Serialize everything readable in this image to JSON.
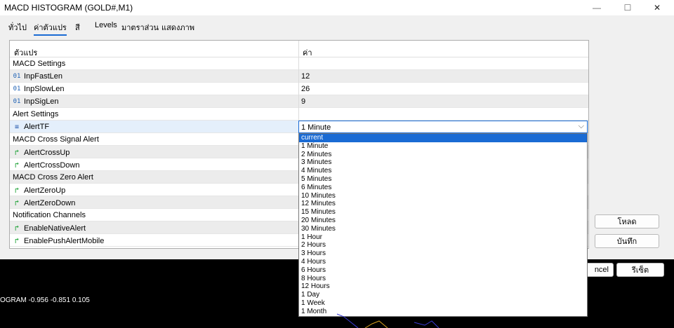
{
  "window": {
    "title": "MACD HISTOGRAM (GOLD#,M1)"
  },
  "tabs": [
    {
      "label": "ทั่วไป"
    },
    {
      "label": "ค่าตัวแปร"
    },
    {
      "label": "สี"
    },
    {
      "label": "Levels"
    },
    {
      "label": "มาตราส่วน"
    },
    {
      "label": "แสดงภาพ"
    }
  ],
  "grid": {
    "col_param": "ตัวแปร",
    "col_value": "ค่า",
    "rows": [
      {
        "label": "MACD Settings",
        "value": ""
      },
      {
        "icon": "01",
        "label": "InpFastLen",
        "value": "12"
      },
      {
        "icon": "01",
        "label": "InpSlowLen",
        "value": "26"
      },
      {
        "icon": "01",
        "label": "InpSigLen",
        "value": "9"
      },
      {
        "label": "Alert Settings",
        "value": ""
      },
      {
        "label": "AlertTF",
        "value": ""
      },
      {
        "label": "MACD Cross Signal Alert",
        "value": ""
      },
      {
        "label": "AlertCrossUp",
        "value": ""
      },
      {
        "label": "AlertCrossDown",
        "value": ""
      },
      {
        "label": "MACD Cross Zero Alert",
        "value": ""
      },
      {
        "label": "AlertZeroUp",
        "value": ""
      },
      {
        "label": "AlertZeroDown",
        "value": ""
      },
      {
        "label": "Notification Channels",
        "value": ""
      },
      {
        "label": "EnableNativeAlert",
        "value": ""
      },
      {
        "label": "EnablePushAlertMobile",
        "value": ""
      }
    ]
  },
  "combo": {
    "selected": "1 Minute"
  },
  "dropdown_options": [
    "current",
    "1 Minute",
    "2 Minutes",
    "3 Minutes",
    "4 Minutes",
    "5 Minutes",
    "6 Minutes",
    "10 Minutes",
    "12 Minutes",
    "15 Minutes",
    "20 Minutes",
    "30 Minutes",
    "1 Hour",
    "2 Hours",
    "3 Hours",
    "4 Hours",
    "6 Hours",
    "8 Hours",
    "12 Hours",
    "1 Day",
    "1 Week",
    "1 Month"
  ],
  "buttons": {
    "load": "โหลด",
    "save": "บันทึก",
    "cancel": "ncel",
    "reset": "รีเซ็ต"
  },
  "status_text": "OGRAM -0.956 -0.851 0.105",
  "colors": {
    "accent": "#1a6bd4",
    "arrow": "#22a33a"
  }
}
